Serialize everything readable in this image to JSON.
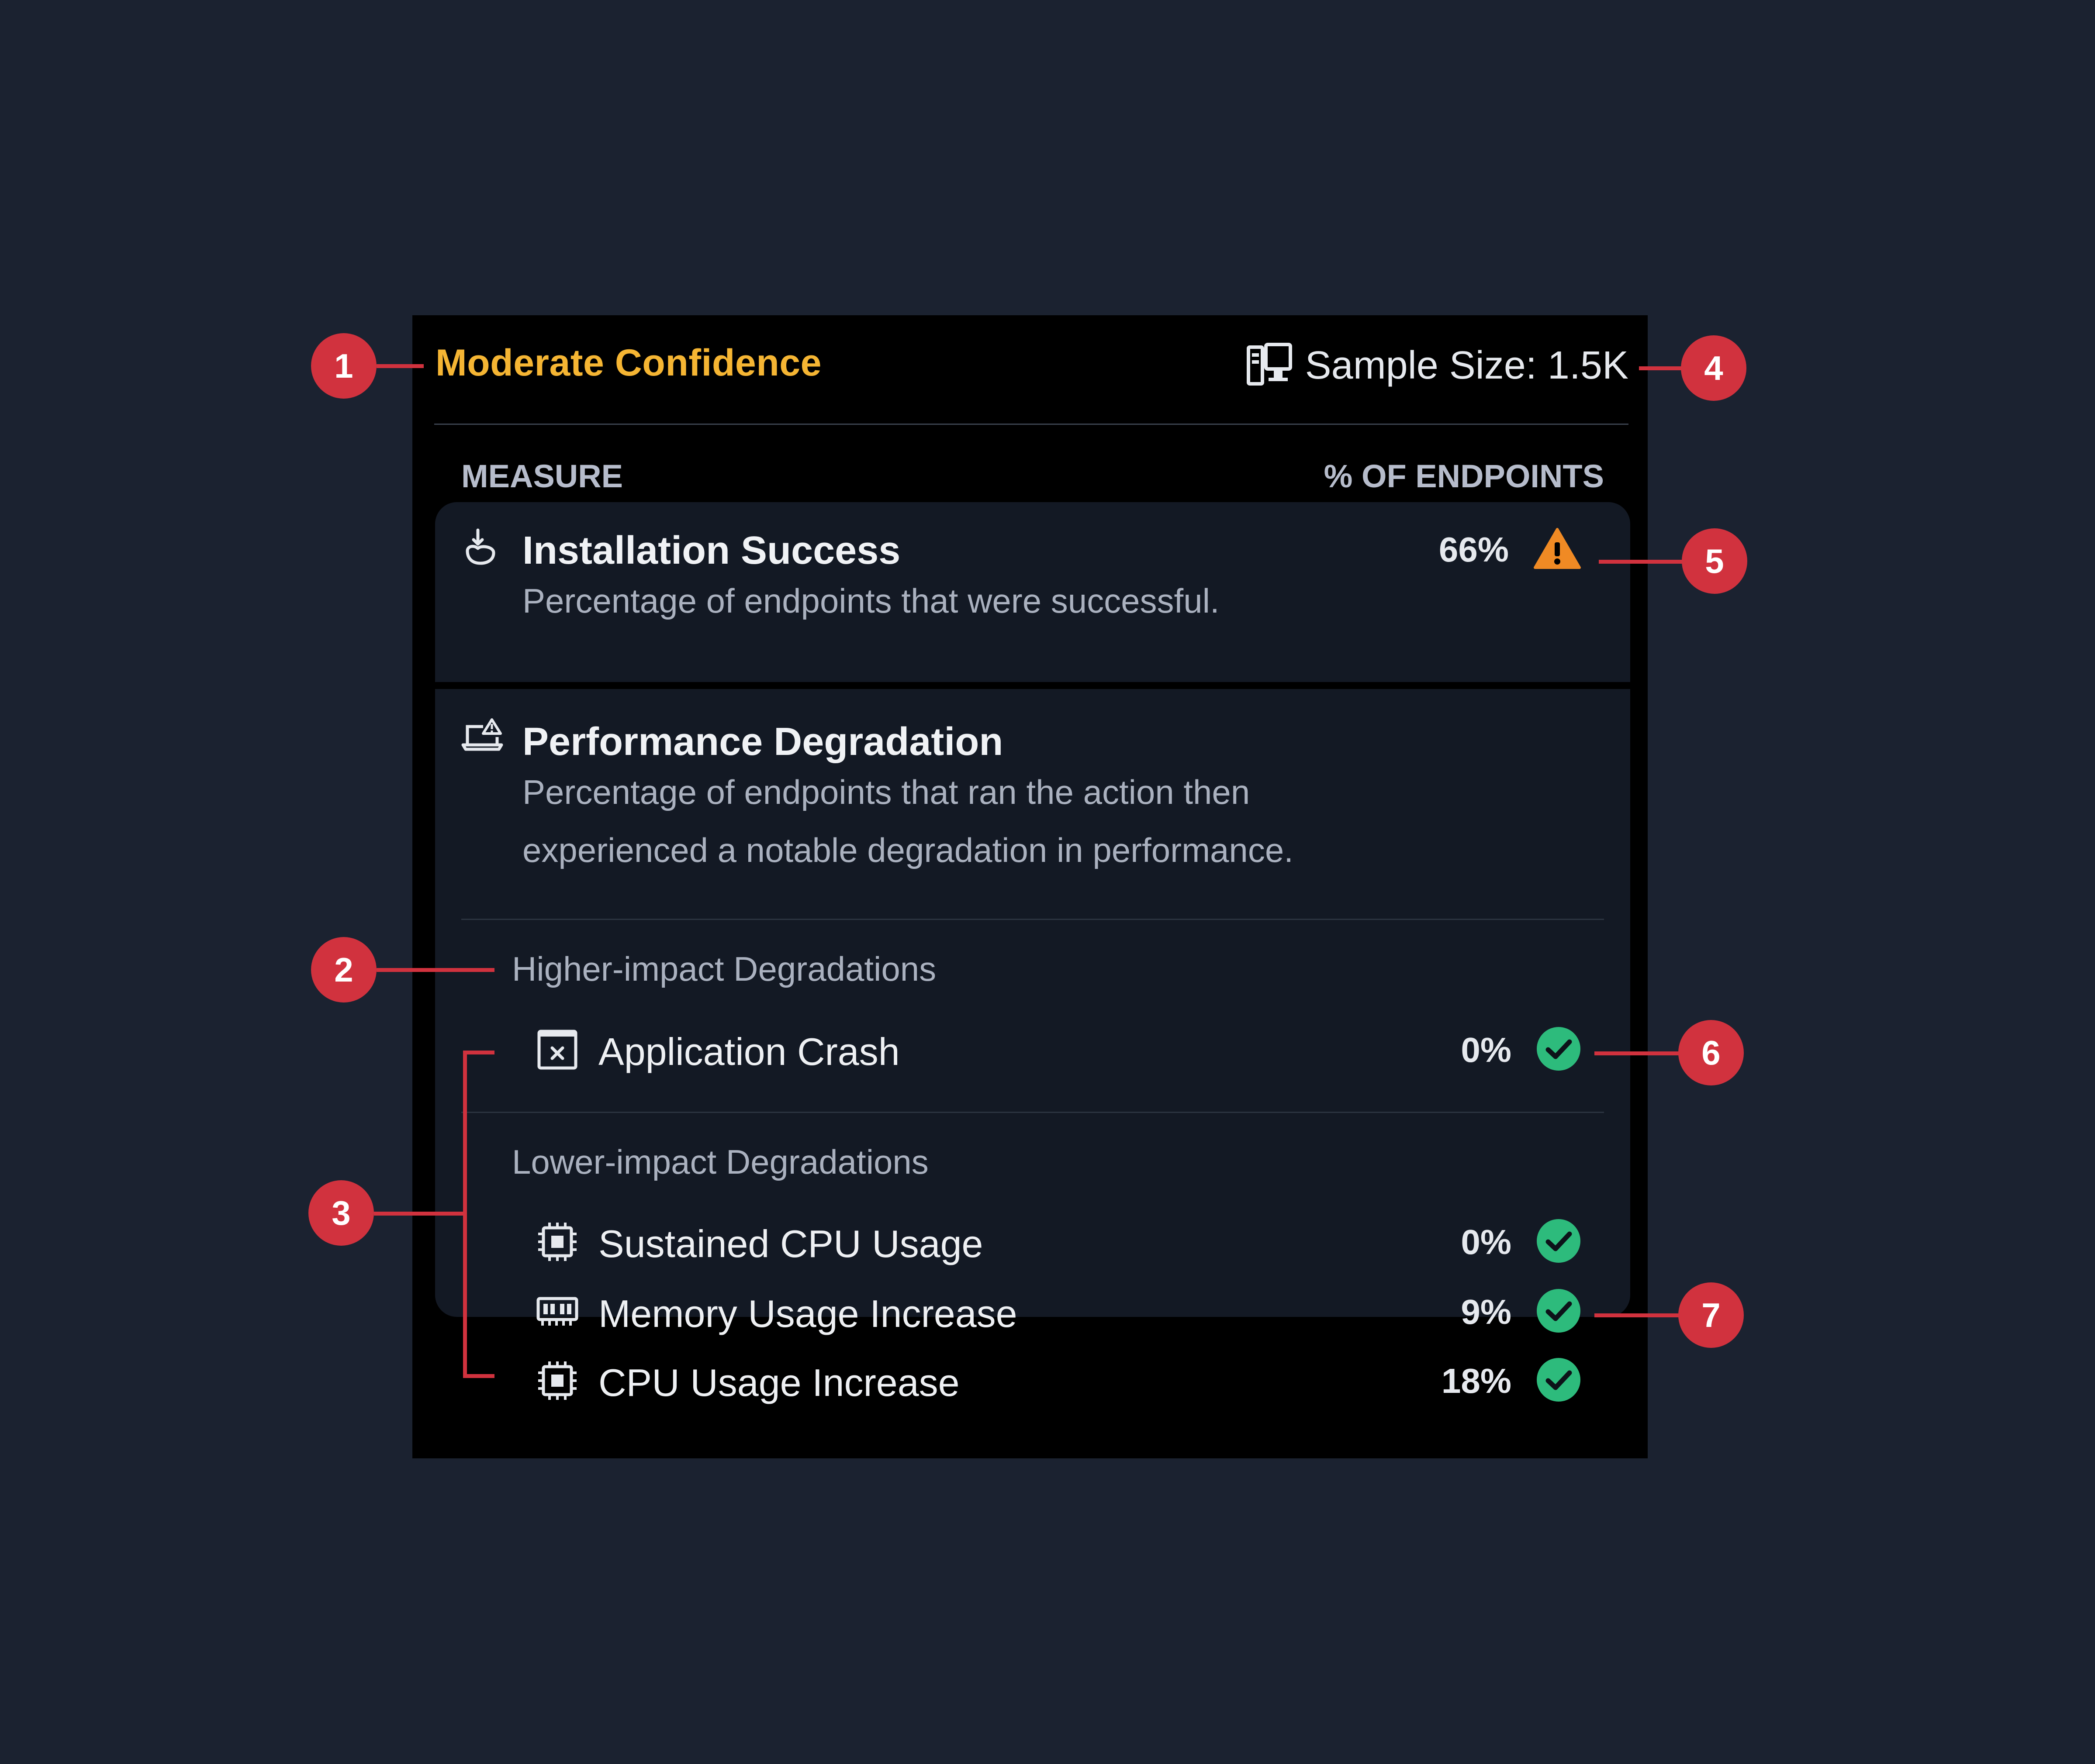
{
  "panel": {
    "confidence_label": "Moderate Confidence",
    "sample_size_label": "Sample Size: 1.5K",
    "sample_icon": "computer-icon",
    "columns": {
      "measure": "MEASURE",
      "endpoints": "% OF ENDPOINTS"
    }
  },
  "measures": {
    "installation": {
      "icon": "install-hand-icon",
      "title": "Installation Success",
      "description": "Percentage of endpoints that were successful.",
      "percent": "66%",
      "status_icon": "warning-icon"
    },
    "performance": {
      "icon": "laptop-warning-icon",
      "title": "Performance Degradation",
      "description_lines": [
        "Percentage of endpoints that ran the action then",
        "experienced a notable degradation in performance."
      ],
      "higher_impact": {
        "title": "Higher-impact Degradations",
        "items": [
          {
            "icon": "app-crash-icon",
            "label": "Application Crash",
            "percent": "0%",
            "status_icon": "check-circle-icon"
          }
        ]
      },
      "lower_impact": {
        "title": "Lower-impact Degradations",
        "items": [
          {
            "icon": "cpu-icon",
            "label": "Sustained CPU Usage",
            "percent": "0%",
            "status_icon": "check-circle-icon"
          },
          {
            "icon": "memory-icon",
            "label": "Memory Usage Increase",
            "percent": "9%",
            "status_icon": "check-circle-icon"
          },
          {
            "icon": "cpu-icon",
            "label": "CPU Usage Increase",
            "percent": "18%",
            "status_icon": "check-circle-icon"
          }
        ]
      }
    }
  },
  "callouts": [
    "1",
    "2",
    "3",
    "4",
    "5",
    "6",
    "7"
  ],
  "colors": {
    "background": "#1b2230",
    "panel": "#000000",
    "card": "#131924",
    "confidence": "#f5b533",
    "warning": "#f08a24",
    "success": "#2dbb7c",
    "callout": "#d1323e"
  }
}
